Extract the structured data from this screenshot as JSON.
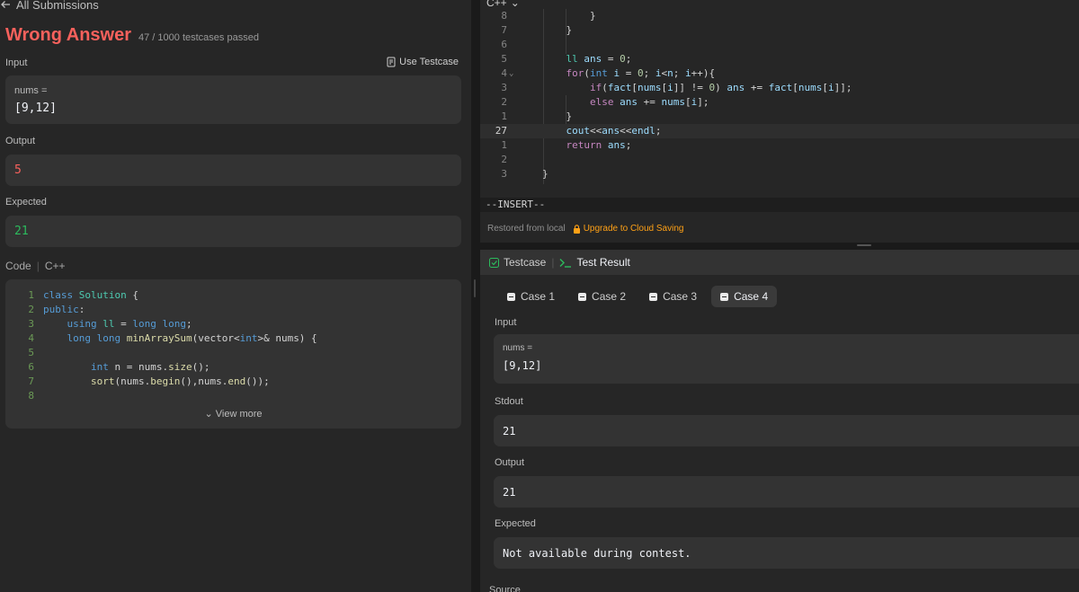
{
  "left": {
    "back_label": "All Submissions",
    "result_title": "Wrong Answer",
    "result_sub": "47 / 1000 testcases passed",
    "input_label": "Input",
    "use_testcase": "Use Testcase",
    "input_var": "nums =",
    "input_val": "[9,12]",
    "output_label": "Output",
    "output_val": "5",
    "expected_label": "Expected",
    "expected_val": "21",
    "code_label": "Code",
    "code_lang": "C++",
    "view_more": "View more",
    "code_lines": [
      {
        "n": "1",
        "html": "<span class=\"kw\">class</span> <span class=\"ty\">Solution</span> <span class=\"pl\">{</span>"
      },
      {
        "n": "2",
        "html": "<span class=\"kw\">public</span><span class=\"pl\">:</span>"
      },
      {
        "n": "3",
        "html": "    <span class=\"kw\">using</span> <span class=\"ty\">ll</span> <span class=\"pl\">=</span> <span class=\"kw\">long long</span><span class=\"pl\">;</span>"
      },
      {
        "n": "4",
        "html": "    <span class=\"kw\">long long</span> <span class=\"fn\">minArraySum</span><span class=\"pl\">(vector&lt;</span><span class=\"kw\">int</span><span class=\"pl\">&gt;&amp; nums) {</span>"
      },
      {
        "n": "5",
        "html": ""
      },
      {
        "n": "6",
        "html": "        <span class=\"kw\">int</span> <span class=\"pl\">n = nums.</span><span class=\"fn\">size</span><span class=\"pl\">();</span>"
      },
      {
        "n": "7",
        "html": "        <span class=\"fn\">sort</span><span class=\"pl\">(nums.</span><span class=\"fn\">begin</span><span class=\"pl\">(),nums.</span><span class=\"fn\">end</span><span class=\"pl\">());</span>"
      },
      {
        "n": "8",
        "html": ""
      }
    ]
  },
  "editor": {
    "language": "C++",
    "insert_mode": "--INSERT--",
    "restored": "Restored from local",
    "upgrade": "Upgrade to Cloud Saving",
    "lines": [
      {
        "n": "8",
        "html": "        <span class=\"pl\">}</span>"
      },
      {
        "n": "7",
        "html": "    <span class=\"pl\">}</span>"
      },
      {
        "n": "6",
        "html": ""
      },
      {
        "n": "5",
        "html": "    <span class=\"ty\">ll</span> <span class=\"vr\">ans</span> <span class=\"pl\">=</span> <span class=\"num\">0</span><span class=\"pl\">;</span>"
      },
      {
        "n": "4",
        "fold": true,
        "html": "    <span class=\"ctl\">for</span><span class=\"pl\">(</span><span class=\"kw\">int</span> <span class=\"vr\">i</span> <span class=\"pl\">=</span> <span class=\"num\">0</span><span class=\"pl\">;</span> <span class=\"vr\">i</span><span class=\"pl\">&lt;</span><span class=\"vr\">n</span><span class=\"pl\">;</span> <span class=\"vr\">i</span><span class=\"pl\">++){</span>"
      },
      {
        "n": "3",
        "html": "        <span class=\"ctl\">if</span><span class=\"pl\">(</span><span class=\"vr\">fact</span><span class=\"pl\">[</span><span class=\"vr\">nums</span><span class=\"pl\">[</span><span class=\"vr\">i</span><span class=\"pl\">]]</span> <span class=\"pl\">!=</span> <span class=\"num\">0</span><span class=\"pl\">)</span> <span class=\"vr\">ans</span> <span class=\"pl\">+=</span> <span class=\"vr\">fact</span><span class=\"pl\">[</span><span class=\"vr\">nums</span><span class=\"pl\">[</span><span class=\"vr\">i</span><span class=\"pl\">]];</span>"
      },
      {
        "n": "2",
        "html": "        <span class=\"ctl\">else</span> <span class=\"vr\">ans</span> <span class=\"pl\">+=</span> <span class=\"vr\">nums</span><span class=\"pl\">[</span><span class=\"vr\">i</span><span class=\"pl\">];</span>"
      },
      {
        "n": "1",
        "html": "    <span class=\"pl\">}</span>"
      },
      {
        "n": "27",
        "current": true,
        "html": "    <span class=\"vr\">cout</span><span class=\"pl\">&lt;&lt;</span><span class=\"vr\">ans</span><span class=\"pl\">&lt;&lt;</span><span class=\"vr\">endl</span><span class=\"pl\">;</span>"
      },
      {
        "n": "1",
        "html": "    <span class=\"ctl\">return</span> <span class=\"vr\">ans</span><span class=\"pl\">;</span>"
      },
      {
        "n": "2",
        "html": ""
      },
      {
        "n": "3",
        "html": "<span class=\"pl\">}</span>"
      }
    ]
  },
  "test": {
    "tab_testcase": "Testcase",
    "tab_result": "Test Result",
    "cases": [
      "Case 1",
      "Case 2",
      "Case 3",
      "Case 4"
    ],
    "active_case": 3,
    "input_label": "Input",
    "input_var": "nums =",
    "input_val": "[9,12]",
    "stdout_label": "Stdout",
    "stdout_val": "21",
    "output_label": "Output",
    "output_val": "21",
    "expected_label": "Expected",
    "expected_val": "Not available during contest.",
    "source_label": "Source"
  },
  "colors": {
    "wrong": "#f8615c",
    "accent_orange": "#ffa116",
    "green": "#2cbb5d"
  }
}
